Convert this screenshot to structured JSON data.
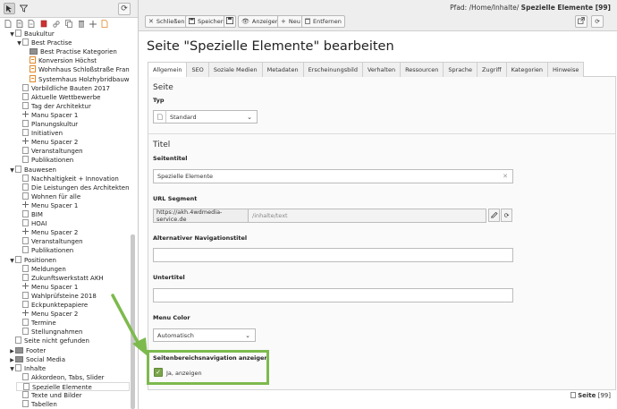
{
  "left_toolbar": {
    "icons": [
      "cursor-icon",
      "filter-icon"
    ]
  },
  "tree_toolbar": {
    "icons": [
      "new-page-icon",
      "new-folder-icon",
      "new-link-icon",
      "delete-icon",
      "link-icon",
      "spacer-icon",
      "trash-icon",
      "move-icon",
      "copy-icon"
    ]
  },
  "tree": {
    "items": [
      {
        "label": "Baukultur",
        "indent": 1,
        "type": "page",
        "arrow": "▼"
      },
      {
        "label": "Best Practise",
        "indent": 2,
        "type": "page",
        "arrow": "▼"
      },
      {
        "label": "Best Practise Kategorien",
        "indent": 3,
        "type": "folder",
        "arrow": ""
      },
      {
        "label": "Konversion Höchst",
        "indent": 3,
        "type": "orange",
        "arrow": ""
      },
      {
        "label": "Wohnhaus Schloßstraße Frank",
        "indent": 3,
        "type": "orange",
        "arrow": ""
      },
      {
        "label": "Systemhaus Holzhybridbauwei",
        "indent": 3,
        "type": "orange",
        "arrow": ""
      },
      {
        "label": "Vorbildliche Bauten 2017",
        "indent": 2,
        "type": "page",
        "arrow": ""
      },
      {
        "label": "Aktuelle Wettbewerbe",
        "indent": 2,
        "type": "page",
        "arrow": ""
      },
      {
        "label": "Tag der Architektur",
        "indent": 2,
        "type": "page",
        "arrow": ""
      },
      {
        "label": "Manu Spacer 1",
        "indent": 2,
        "type": "spacer",
        "arrow": ""
      },
      {
        "label": "Planungskultur",
        "indent": 2,
        "type": "page",
        "arrow": ""
      },
      {
        "label": "Initiativen",
        "indent": 2,
        "type": "page",
        "arrow": ""
      },
      {
        "label": "Menu Spacer 2",
        "indent": 2,
        "type": "spacer",
        "arrow": ""
      },
      {
        "label": "Veranstaltungen",
        "indent": 2,
        "type": "page",
        "arrow": ""
      },
      {
        "label": "Publikationen",
        "indent": 2,
        "type": "page",
        "arrow": ""
      },
      {
        "label": "Bauwesen",
        "indent": 1,
        "type": "page",
        "arrow": "▼"
      },
      {
        "label": "Nachhaltigkeit + Innovation",
        "indent": 2,
        "type": "page",
        "arrow": ""
      },
      {
        "label": "Die Leistungen des Architekten",
        "indent": 2,
        "type": "page",
        "arrow": ""
      },
      {
        "label": "Wohnen für alle",
        "indent": 2,
        "type": "page",
        "arrow": ""
      },
      {
        "label": "Menu Spacer 1",
        "indent": 2,
        "type": "spacer",
        "arrow": ""
      },
      {
        "label": "BIM",
        "indent": 2,
        "type": "page",
        "arrow": ""
      },
      {
        "label": "HOAI",
        "indent": 2,
        "type": "page",
        "arrow": ""
      },
      {
        "label": "Menu Spacer 2",
        "indent": 2,
        "type": "spacer",
        "arrow": ""
      },
      {
        "label": "Veranstaltungen",
        "indent": 2,
        "type": "page",
        "arrow": ""
      },
      {
        "label": "Publikationen",
        "indent": 2,
        "type": "page",
        "arrow": ""
      },
      {
        "label": "Positionen",
        "indent": 1,
        "type": "page",
        "arrow": "▼"
      },
      {
        "label": "Meldungen",
        "indent": 2,
        "type": "page",
        "arrow": ""
      },
      {
        "label": "Zukunftswerkstatt AKH",
        "indent": 2,
        "type": "page",
        "arrow": ""
      },
      {
        "label": "Menu Spacer 1",
        "indent": 2,
        "type": "spacer",
        "arrow": ""
      },
      {
        "label": "Wahlprüfsteine 2018",
        "indent": 2,
        "type": "page",
        "arrow": ""
      },
      {
        "label": "Eckpunktepapiere",
        "indent": 2,
        "type": "page",
        "arrow": ""
      },
      {
        "label": "Menu Spacer 2",
        "indent": 2,
        "type": "spacer",
        "arrow": ""
      },
      {
        "label": "Termine",
        "indent": 2,
        "type": "page",
        "arrow": ""
      },
      {
        "label": "Stellungnahmen",
        "indent": 2,
        "type": "page",
        "arrow": ""
      },
      {
        "label": "Seite nicht gefunden",
        "indent": 1,
        "type": "page",
        "arrow": ""
      },
      {
        "label": "Footer",
        "indent": 1,
        "type": "folder",
        "arrow": "▶"
      },
      {
        "label": "Social Media",
        "indent": 1,
        "type": "folder",
        "arrow": "▶"
      },
      {
        "label": "Inhalte",
        "indent": 1,
        "type": "page",
        "arrow": "▼"
      },
      {
        "label": "Akkordeon, Tabs, Slider",
        "indent": 2,
        "type": "page",
        "arrow": ""
      },
      {
        "label": "Spezielle Elemente",
        "indent": 2,
        "type": "page",
        "arrow": "",
        "selected": true
      },
      {
        "label": "Texte und Bilder",
        "indent": 2,
        "type": "page",
        "arrow": ""
      },
      {
        "label": "Tabellen",
        "indent": 2,
        "type": "page",
        "arrow": ""
      }
    ]
  },
  "topbar": {
    "path_prefix": "Pfad: /Home/Inhalte/",
    "path_current": "Spezielle Elemente [99]"
  },
  "buttons": {
    "close": "Schließen",
    "save": "Speichern",
    "view": "Anzeigen",
    "new": "Neu",
    "remove": "Entfernen"
  },
  "page_title": "Seite \"Spezielle Elemente\" bearbeiten",
  "tabs": [
    "Allgemein",
    "SEO",
    "Soziale Medien",
    "Metadaten",
    "Erscheinungsbild",
    "Verhalten",
    "Ressourcen",
    "Sprache",
    "Zugriff",
    "Kategorien",
    "Hinweise"
  ],
  "form": {
    "section_page": "Seite",
    "type_label": "Typ",
    "type_value": "Standard",
    "section_title": "Titel",
    "seitentitel_label": "Seitentitel",
    "seitentitel_value": "Spezielle Elemente",
    "url_label": "URL Segment",
    "url_prefix": "https://akh.4wdmedia-service.de",
    "url_value": "/inhalte/text",
    "alt_nav_label": "Alternativer Navigationstitel",
    "subtitle_label": "Untertitel",
    "menu_color_label": "Menu Color",
    "menu_color_value": "Automatisch",
    "sidenav_label": "Seitenbereichsnavigation anzeigen",
    "sidenav_value": "Ja, anzeigen"
  },
  "footer": {
    "label": "Seite",
    "id": "[99]"
  },
  "colors": {
    "accent_green": "#7dba4d",
    "checkbox_green": "#79a548"
  }
}
